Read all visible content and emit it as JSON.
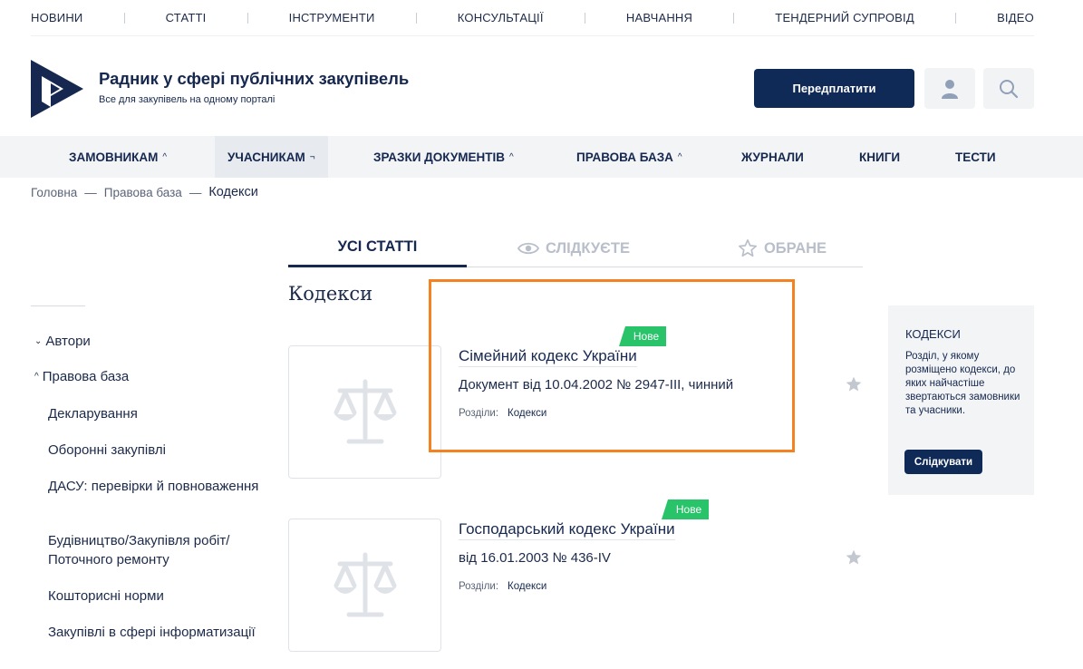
{
  "topnav": [
    "НОВИНИ",
    "СТАТТІ",
    "ІНСТРУМЕНТИ",
    "КОНСУЛЬТАЦІЇ",
    "НАВЧАННЯ",
    "ТЕНДЕРНИЙ СУПРОВІД",
    "ВІДЕО"
  ],
  "header": {
    "title": "Радник у сфері публічних закупівель",
    "subtitle": "Все для закупівель на одному порталі",
    "subscribe_label": "Передплатити",
    "user_icon": "user-icon",
    "search_icon": "search-icon"
  },
  "mainnav": [
    {
      "label": "ЗАМОВНИКАМ",
      "chevron": "^"
    },
    {
      "label": "УЧАСНИКАМ",
      "chevron": "¬"
    },
    {
      "label": "ЗРАЗКИ ДОКУМЕНТІВ",
      "chevron": "^"
    },
    {
      "label": "ПРАВОВА БАЗА",
      "chevron": "^"
    },
    {
      "label": "ЖУРНАЛИ",
      "chevron": ""
    },
    {
      "label": "КНИГИ",
      "chevron": ""
    },
    {
      "label": "ТЕСТИ",
      "chevron": ""
    }
  ],
  "breadcrumb": {
    "home": "Головна",
    "section": "Правова база",
    "current": "Кодекси",
    "separator": "—"
  },
  "sidebar": {
    "authors": "Автори",
    "legal_base": "Правова база",
    "items": [
      "Декларування",
      "Оборонні закупівлі",
      "ДАСУ: перевірки й повноваження",
      "Будівництво/Закупівля робіт/ Поточного ремонту",
      "Кошторисні норми",
      "Закупівлі в сфері інформатизації"
    ]
  },
  "tabs": {
    "all": "УСІ СТАТТІ",
    "watching": "СЛІДКУЄТЕ",
    "favorites": "ОБРАНЕ"
  },
  "page_heading": "Кодекси",
  "cards": [
    {
      "badge": "Нове",
      "title": "Сімейний кодекс України",
      "desc": "Документ від 10.04.2002 № 2947-III, чинний",
      "meta_label": "Розділи:",
      "meta_link": "Кодекси"
    },
    {
      "badge": "Нове",
      "title": "Господарський кодекс України",
      "desc": "від 16.01.2003 № 436-IV",
      "meta_label": "Розділи:",
      "meta_link": "Кодекси"
    }
  ],
  "rightbox": {
    "heading": "КОДЕКСИ",
    "text": "Розділ, у якому розміщено кодекси, до яких найчастіше звертаються замовники та учасники.",
    "button": "Слідкувати"
  },
  "colors": {
    "primary": "#0f2a57",
    "badge": "#29c46a",
    "highlight": "#f58220"
  }
}
